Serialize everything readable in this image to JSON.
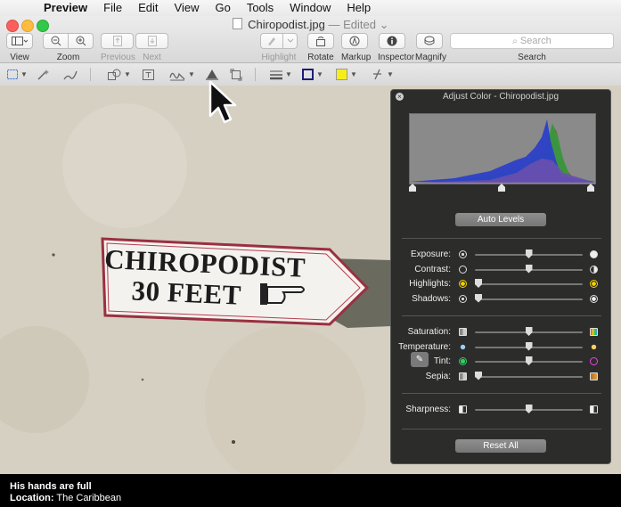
{
  "menubar": {
    "items": [
      "Preview",
      "File",
      "Edit",
      "View",
      "Go",
      "Tools",
      "Window",
      "Help"
    ]
  },
  "window": {
    "title": "Chiropodist.jpg",
    "title_suffix": "— Edited ⌄"
  },
  "toolbar": {
    "view": "View",
    "zoom": "Zoom",
    "previous": "Previous",
    "next": "Next",
    "highlight": "Highlight",
    "rotate": "Rotate",
    "markup": "Markup",
    "inspector": "Inspector",
    "magnify": "Magnify",
    "search_placeholder": "Search",
    "search_label": "Search"
  },
  "markup_colors": {
    "border": "#1c1c7a",
    "fill": "#f5ee1a"
  },
  "sign": {
    "line1": "CHIROPODIST",
    "line2": "30 FEET"
  },
  "panel": {
    "title": "Adjust Color - Chiropodist.jpg",
    "auto_levels": "Auto Levels",
    "reset_all": "Reset All",
    "levels": [
      0.0,
      0.5,
      1.0
    ],
    "group1": [
      {
        "label": "Exposure:",
        "value": 0.5
      },
      {
        "label": "Contrast:",
        "value": 0.5
      },
      {
        "label": "Highlights:",
        "value": 0.0
      },
      {
        "label": "Shadows:",
        "value": 0.0
      }
    ],
    "group2": [
      {
        "label": "Saturation:",
        "value": 0.5
      },
      {
        "label": "Temperature:",
        "value": 0.5
      },
      {
        "label": "Tint:",
        "value": 0.5
      },
      {
        "label": "Sepia:",
        "value": 0.0
      }
    ],
    "group3": [
      {
        "label": "Sharpness:",
        "value": 0.5
      }
    ]
  },
  "caption": {
    "line1": "His hands are full",
    "location_label": "Location:",
    "location_value": "The Caribbean"
  }
}
